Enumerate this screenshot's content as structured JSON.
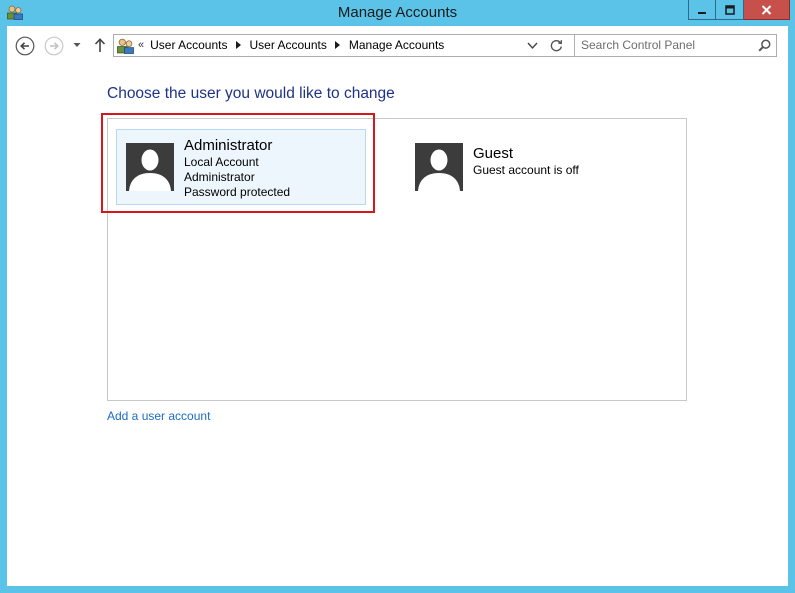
{
  "window": {
    "title": "Manage Accounts",
    "icons": {
      "app": "user-accounts-icon",
      "minimize": "minimize-icon",
      "maximize": "maximize-icon",
      "close": "close-icon"
    }
  },
  "navigation": {
    "back_icon": "back-arrow-icon",
    "forward_icon": "forward-arrow-icon",
    "recent_icon": "chevron-down-icon",
    "up_icon": "up-arrow-icon"
  },
  "address_bar": {
    "overflow": "«",
    "crumbs": [
      "User Accounts",
      "User Accounts",
      "Manage Accounts"
    ],
    "icons": {
      "location": "user-accounts-icon",
      "dropdown": "chevron-down-icon",
      "refresh": "refresh-icon"
    }
  },
  "search": {
    "placeholder": "Search Control Panel",
    "value": "",
    "icon": "search-icon"
  },
  "content": {
    "heading": "Choose the user you would like to change",
    "accounts": [
      {
        "name": "Administrator",
        "details": [
          "Local Account",
          "Administrator",
          "Password protected"
        ],
        "icon": "user-avatar-icon",
        "selected": true
      },
      {
        "name": "Guest",
        "details": [
          "Guest account is off"
        ],
        "icon": "user-avatar-icon",
        "selected": false
      }
    ],
    "add_account_link": "Add a user account"
  },
  "colors": {
    "frame": "#5bc3e8",
    "heading": "#1e3287",
    "link": "#1a6bc6",
    "selected_tile": "#eef6fd",
    "highlight_box": "#d8171d",
    "close_button": "#c7504b"
  }
}
